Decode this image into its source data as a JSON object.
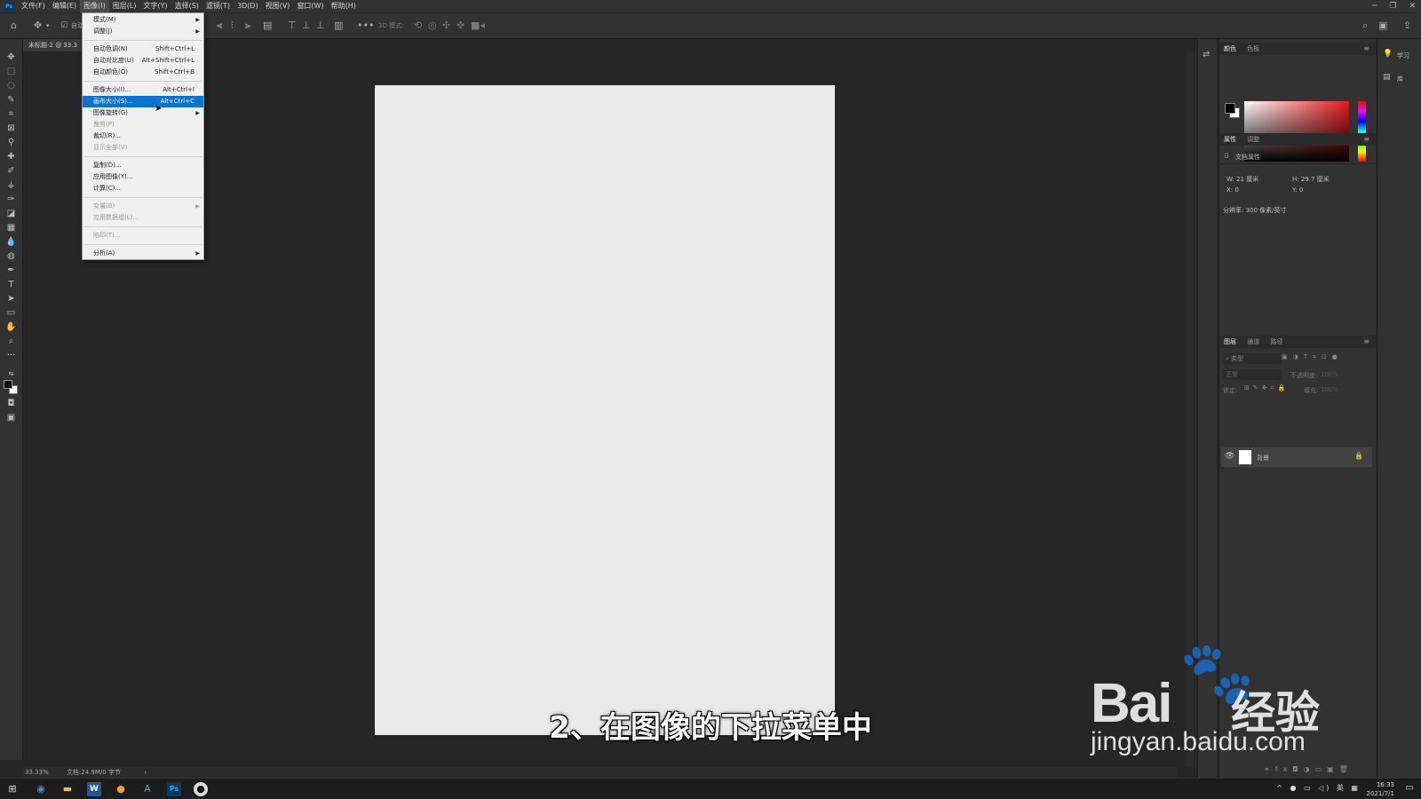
{
  "menubar": {
    "logo": "Ps",
    "items": [
      "文件(F)",
      "编辑(E)",
      "图像(I)",
      "图层(L)",
      "文字(Y)",
      "选择(S)",
      "滤镜(T)",
      "3D(D)",
      "视图(V)",
      "窗口(W)",
      "帮助(H)"
    ],
    "window_controls": [
      "─",
      "❐",
      "✕"
    ]
  },
  "document_tab": {
    "title": "未标题-2 @ 33.3"
  },
  "optionbar": {
    "autoselect": "自动",
    "mode3d": "3D 模式:"
  },
  "image_menu": {
    "items": [
      {
        "label": "模式(M)",
        "shortcut": "",
        "submenu": true,
        "disabled": false
      },
      {
        "label": "调整(J)",
        "shortcut": "",
        "submenu": true,
        "disabled": false
      },
      {
        "label": "自动色调(N)",
        "shortcut": "Shift+Ctrl+L",
        "submenu": false,
        "disabled": false
      },
      {
        "label": "自动对比度(U)",
        "shortcut": "Alt+Shift+Ctrl+L",
        "submenu": false,
        "disabled": false
      },
      {
        "label": "自动颜色(O)",
        "shortcut": "Shift+Ctrl+B",
        "submenu": false,
        "disabled": false
      },
      {
        "label": "图像大小(I)...",
        "shortcut": "Alt+Ctrl+I",
        "submenu": false,
        "disabled": false
      },
      {
        "label": "画布大小(S)...",
        "shortcut": "Alt+Ctrl+C",
        "submenu": false,
        "disabled": false,
        "highlighted": true
      },
      {
        "label": "图像旋转(G)",
        "shortcut": "",
        "submenu": true,
        "disabled": false
      },
      {
        "label": "裁剪(P)",
        "shortcut": "",
        "submenu": false,
        "disabled": true
      },
      {
        "label": "裁切(R)...",
        "shortcut": "",
        "submenu": false,
        "disabled": false
      },
      {
        "label": "显示全部(V)",
        "shortcut": "",
        "submenu": false,
        "disabled": true
      },
      {
        "label": "复制(D)...",
        "shortcut": "",
        "submenu": false,
        "disabled": false
      },
      {
        "label": "应用图像(Y)...",
        "shortcut": "",
        "submenu": false,
        "disabled": false
      },
      {
        "label": "计算(C)...",
        "shortcut": "",
        "submenu": false,
        "disabled": false
      },
      {
        "label": "变量(B)",
        "shortcut": "",
        "submenu": true,
        "disabled": true
      },
      {
        "label": "应用数据组(L)...",
        "shortcut": "",
        "submenu": false,
        "disabled": true
      },
      {
        "label": "陷印(T)...",
        "shortcut": "",
        "submenu": false,
        "disabled": true
      },
      {
        "label": "分析(A)",
        "shortcut": "",
        "submenu": true,
        "disabled": false
      }
    ]
  },
  "color_panel": {
    "tabs": [
      "颜色",
      "色板"
    ]
  },
  "properties_panel": {
    "tabs": [
      "属性",
      "调整"
    ],
    "doc_label": "文档属性",
    "w": "W: 21 厘米",
    "h": "H: 29.7 厘米",
    "x": "X: 0",
    "y": "Y: 0",
    "resolution": "分辨率: 300 像素/英寸"
  },
  "layers_panel": {
    "tabs": [
      "图层",
      "通道",
      "路径"
    ],
    "filter_placeholder": "类型",
    "blend_mode": "正常",
    "opacity_label": "不透明度:",
    "opacity": "100%",
    "lock_label": "锁定:",
    "fill_label": "填充:",
    "fill": "100%",
    "layers": [
      {
        "name": "背景",
        "visible": true,
        "locked": true
      }
    ]
  },
  "right_strip": {
    "learn": "学习",
    "libraries": "库"
  },
  "statusbar": {
    "zoom": "33.33%",
    "doc_info": "文档:24.9M/0 字节"
  },
  "subtitle": "2、在图像的下拉菜单中",
  "watermark": {
    "brand": "Bai",
    "brand2": "经验",
    "url": "jingyan.baidu.com"
  },
  "taskbar": {
    "time": "16:33",
    "date": "2021/7/1",
    "ime": "英"
  }
}
